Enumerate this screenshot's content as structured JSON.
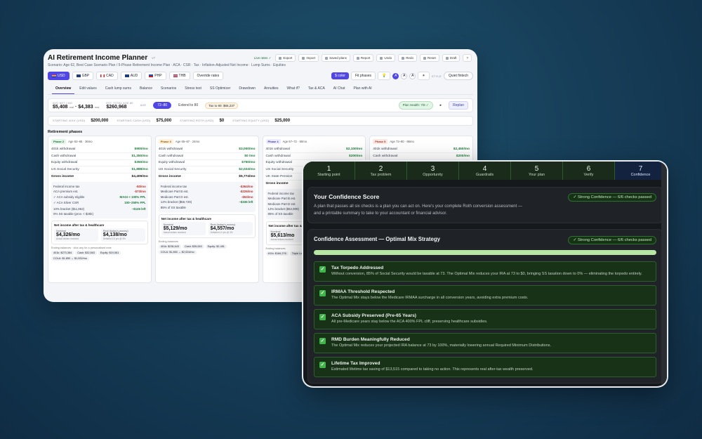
{
  "back": {
    "title": "AI Retirement Income Planner",
    "version": "v7",
    "live": "Live rates ✓",
    "toolbar": [
      "Export",
      "Import",
      "Saved plans",
      "Report",
      "Undo",
      "Redo",
      "Reset",
      "Draft",
      "?"
    ],
    "scenario": "Scenario: Age 62, Best Case Scenario Plan / 5-Phase Retirement Income Plan · ACA · CSR · Tax · Inflation-Adjusted Net Income · Lump Sums · Equities",
    "currencies": [
      "USD",
      "GBP",
      "CAD",
      "AUD",
      "PHP",
      "THB"
    ],
    "override": "Override rates",
    "color_btn": "$ color",
    "fit_btn": "Fit phases",
    "style_label": "STYLE",
    "style_value": "Quiet fintech",
    "tabs": [
      "Overview",
      "Edit values",
      "Cash lump sums",
      "Balance",
      "Scenarios",
      "Stress test",
      "SS Optimizer",
      "Drawdown",
      "Annuities",
      "What if?",
      "Tax & ACA",
      "AI Chat",
      "Plan with AI"
    ],
    "summary": {
      "l1": "AVG NET / MO",
      "v1a": "$5,408",
      "v1a_unit": "real",
      "v1b": "$4,383",
      "v1b_unit": "real",
      "l2": "EST. TOTAL AGE 80",
      "v2": "$260,968",
      "age_label": "AGE",
      "age": "72–80",
      "extend": "Extend to 80",
      "tax": "Tax to 80: $65,237",
      "health": "Plan Health: 7/8 ✓",
      "replan": "Replan"
    },
    "starting": [
      {
        "l": "STARTING 401K (USD)",
        "v": "$200,000"
      },
      {
        "l": "STARTING CASH (USD)",
        "v": "$75,000"
      },
      {
        "l": "STARTING ROTH (USD)",
        "v": "$0"
      },
      {
        "l": "STARTING EQUITY (USD)",
        "v": "$25,000"
      }
    ],
    "phases_title": "Retirement phases",
    "phases": [
      {
        "tag": "Phase 2",
        "tagbg": "#e3f5e6",
        "tagfg": "#1d6b3a",
        "age": "Age 62–65 · 36mo",
        "rows": [
          [
            "401k withdrawal",
            "$900/mo"
          ],
          [
            "Cash withdrawal",
            "$1,350/mo"
          ],
          [
            "Equity withdrawal",
            "$350/mo"
          ],
          [
            "US Social Security",
            "$1,888/mo"
          ]
        ],
        "gross": [
          "Gross income",
          "$4,409/mo"
        ],
        "tax": [
          [
            "Federal income tax",
            "-$0/mo"
          ],
          [
            "ACA premium est.",
            "-$73/mo"
          ],
          [
            "✓ ACA subsidy eligible",
            "MAGI < 100% FPL"
          ],
          [
            "✓ ACA Silver CSR",
            "100–250% FPL"
          ],
          [
            "10% bracket ($11,862)",
            "~$126 left"
          ],
          [
            "0% SS taxable (prov. < $25k)",
            ""
          ]
        ],
        "net": {
          "title": "Net income after tax & healthcare",
          "a_l": "Nominal",
          "a": "$4,326/mo",
          "a_s": "Actual dollars received",
          "b_l": "Real (today's money)",
          "b": "$4,138/mo",
          "b_s": "Deflated 2.5 yrs @ 3%"
        },
        "end": "Ending balances · click any for a personalised note",
        "chips": [
          "401k: $273,384",
          "Cash: $32,563",
          "Equity: $19,061",
          "COLA: $1,850 → $1,932/mo"
        ]
      },
      {
        "tag": "Phase 3",
        "tagbg": "#fff1dc",
        "tagfg": "#9a5a00",
        "age": "Age 65–67 · 24mo",
        "rows": [
          [
            "401k withdrawal",
            "$3,000/mo"
          ],
          [
            "Cash withdrawal",
            "$0 /mo"
          ],
          [
            "Equity withdrawal",
            "$750/mo"
          ],
          [
            "US Social Security",
            "$2,024/mo"
          ]
        ],
        "gross": [
          "Gross income",
          "$5,774/mo"
        ],
        "tax": [
          [
            "Federal income tax",
            "-$364/mo"
          ],
          [
            "Medicare Part B est.",
            "-$226/mo"
          ],
          [
            "Medicare Part D est.",
            "-$53/mo"
          ],
          [
            "12% bracket ($56,729)",
            "~$336 left"
          ],
          [
            "85% of SS taxable",
            ""
          ]
        ],
        "net": {
          "title": "Net income after tax & healthcare",
          "a_l": "Nominal",
          "a": "$5,129/mo",
          "a_s": "Actual dollars received",
          "b_l": "Real (today's money)",
          "b": "$4,557/mo",
          "b_s": "Deflated 4.0 yrs @ 3%"
        },
        "end": "Ending balances",
        "chips": [
          "401k: $236,643",
          "Cash: $35,063",
          "Equity: $2,451",
          "COLA: $1,850 → $2,024/mo"
        ]
      },
      {
        "tag": "Phase 4",
        "tagbg": "#ecebff",
        "tagfg": "#3b3fa8",
        "age": "Age 67–72 · 60mo",
        "rows": [
          [
            "401k withdrawal",
            "$2,100/mo"
          ],
          [
            "Cash withdrawal",
            "$200/mo"
          ],
          [
            "Equity withdrawal",
            "$0/mo"
          ],
          [
            "US Social Security",
            "$2,024/mo"
          ],
          [
            "UK State Pension",
            ""
          ]
        ],
        "gross": [
          "Gross income",
          ""
        ],
        "tax": [
          [
            "Federal income tax",
            ""
          ],
          [
            "Medicare Part B est.",
            ""
          ],
          [
            "Medicare Part D est.",
            ""
          ],
          [
            "12% bracket ($62,909)",
            ""
          ],
          [
            "85% of SS taxable",
            ""
          ]
        ],
        "net": {
          "title": "Net income after tax & healthcare",
          "a_l": "Nominal",
          "a": "$5,613/mo",
          "a_s": "Actual dollars received",
          "b_l": "",
          "b": "",
          "b_s": ""
        },
        "end": "Ending balances",
        "chips": [
          "401k: $184,276",
          "Triple Lock: $1,850 → $2,193/mo"
        ]
      },
      {
        "tag": "Phase 5",
        "tagbg": "#fde8e4",
        "tagfg": "#a0392b",
        "age": "Age 72–80 · 96mo",
        "rows": [
          [
            "401k withdrawal",
            "$2,450/mo"
          ],
          [
            "Cash withdrawal",
            "$200/mo"
          ]
        ],
        "gross": [
          "",
          ""
        ],
        "tax": [],
        "net": null,
        "end": "",
        "chips": []
      }
    ]
  },
  "front": {
    "steps": [
      {
        "n": "1",
        "l": "Starting point"
      },
      {
        "n": "2",
        "l": "Tax problem"
      },
      {
        "n": "3",
        "l": "Opportunity"
      },
      {
        "n": "4",
        "l": "Guardrails"
      },
      {
        "n": "5",
        "l": "Your plan"
      },
      {
        "n": "6",
        "l": "Verify"
      },
      {
        "n": "7",
        "l": "Confidence"
      }
    ],
    "score_title": "Your Confidence Score",
    "score_text": "A plan that passes all six checks is a plan you can act on. Here's your complete Roth conversion assessment — and a printable summary to take to your accountant or financial advisor.",
    "badge": "✓ Strong Confidence — 6/6 checks passed",
    "assess_title": "Confidence Assessment — Optimal Mix Strategy",
    "progress": 1.0,
    "checks": [
      {
        "t": "Tax Torpedo Addressed",
        "d": "Without conversion, 85% of Social Security would be taxable at 73. The Optimal Mix reduces your IRA at 73 to $0, bringing SS taxation down to 0% — eliminating the torpedo entirely."
      },
      {
        "t": "IRMAA Threshold Respected",
        "d": "The Optimal Mix stays below the Medicare IRMAA surcharge in all conversion years, avoiding extra premium costs."
      },
      {
        "t": "ACA Subsidy Preserved (Pre-65 Years)",
        "d": "All pre-Medicare years stay below the ACA 400% FPL cliff, preserving healthcare subsidies."
      },
      {
        "t": "RMD Burden Meaningfully Reduced",
        "d": "The Optimal Mix reduces your projected IRA balance at 73 by 100%, materially lowering annual Required Minimum Distributions."
      },
      {
        "t": "Lifetime Tax Improved",
        "d": "Estimated lifetime tax saving of $13,515 compared to taking no action. This represents real after-tax wealth preserved."
      }
    ]
  }
}
